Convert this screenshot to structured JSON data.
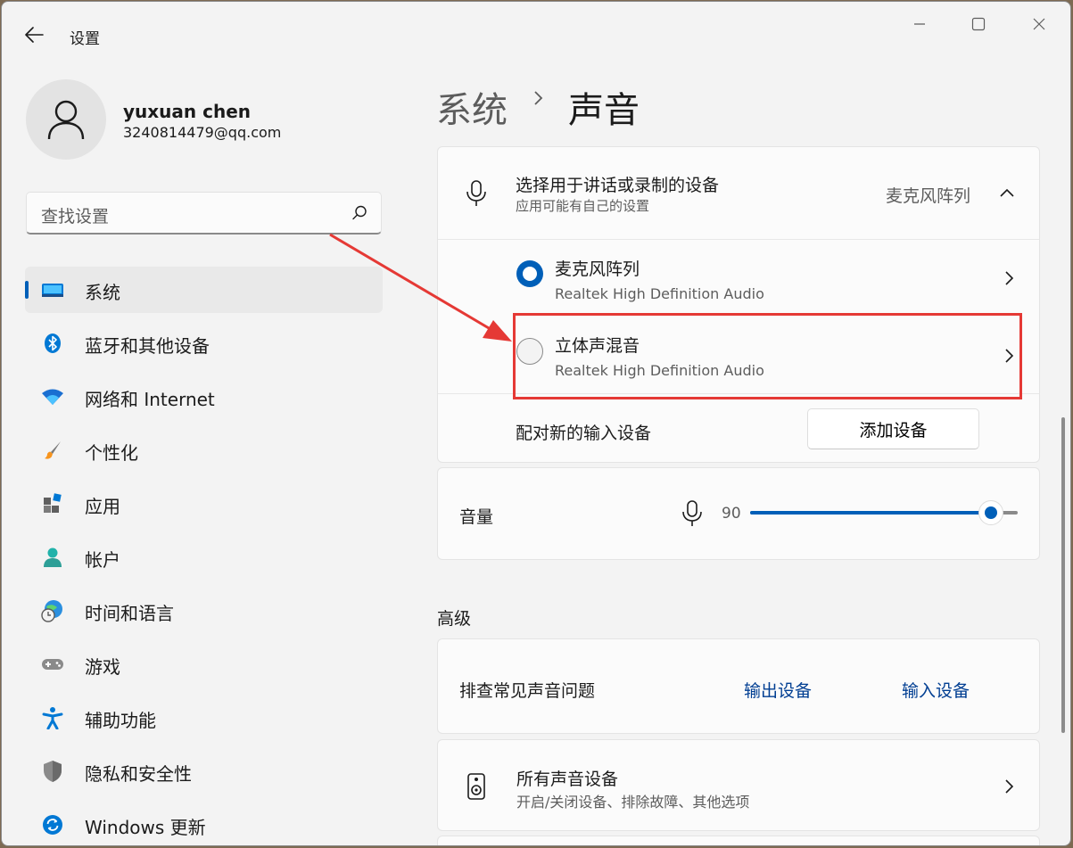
{
  "window": {
    "title": "设置"
  },
  "user": {
    "name": "yuxuan chen",
    "email": "3240814479@qq.com"
  },
  "search": {
    "placeholder": "查找设置"
  },
  "nav": [
    {
      "label": "系统",
      "icon": "system-icon",
      "active": true
    },
    {
      "label": "蓝牙和其他设备",
      "icon": "bluetooth-icon"
    },
    {
      "label": "网络和 Internet",
      "icon": "wifi-icon"
    },
    {
      "label": "个性化",
      "icon": "brush-icon"
    },
    {
      "label": "应用",
      "icon": "apps-icon"
    },
    {
      "label": "帐户",
      "icon": "account-icon"
    },
    {
      "label": "时间和语言",
      "icon": "globe-clock-icon"
    },
    {
      "label": "游戏",
      "icon": "gamepad-icon"
    },
    {
      "label": "辅助功能",
      "icon": "accessibility-icon"
    },
    {
      "label": "隐私和安全性",
      "icon": "shield-icon"
    },
    {
      "label": "Windows 更新",
      "icon": "update-icon"
    }
  ],
  "breadcrumb": {
    "parent": "系统",
    "current": "声音"
  },
  "input": {
    "header_title": "选择用于讲话或录制的设备",
    "header_subtitle": "应用可能有自己的设置",
    "selected_device": "麦克风阵列",
    "devices": [
      {
        "name": "麦克风阵列",
        "driver": "Realtek High Definition Audio",
        "selected": true
      },
      {
        "name": "立体声混音",
        "driver": "Realtek High Definition Audio",
        "selected": false
      }
    ],
    "pair_label": "配对新的输入设备",
    "add_button": "添加设备"
  },
  "volume": {
    "label": "音量",
    "value": "90",
    "level": 0.9
  },
  "advanced": {
    "heading": "高级",
    "troubleshoot_label": "排查常见声音问题",
    "output_link": "输出设备",
    "input_link": "输入设备",
    "all_devices_title": "所有声音设备",
    "all_devices_subtitle": "开启/关闭设备、排除故障、其他选项"
  },
  "colors": {
    "accent": "#005fb8",
    "annotation": "#e53935",
    "background": "#f3f3f3"
  }
}
